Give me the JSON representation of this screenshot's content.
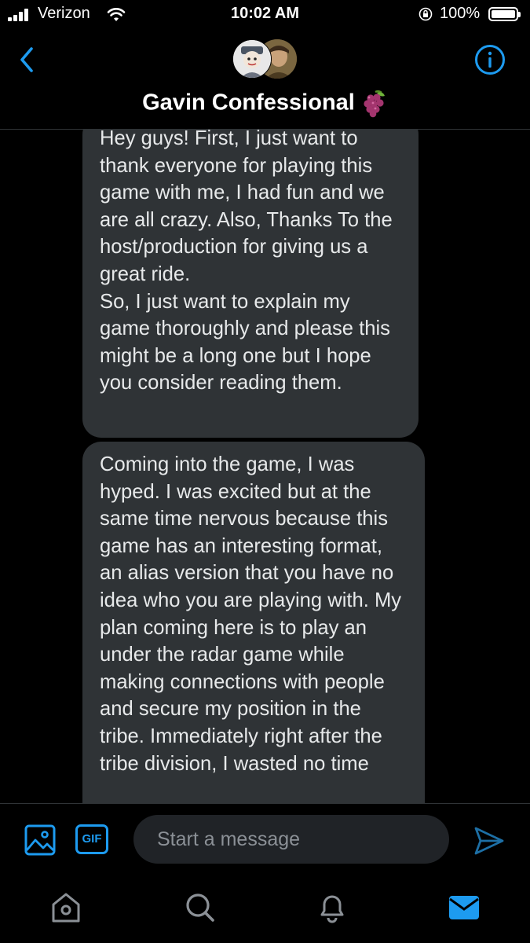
{
  "status_bar": {
    "carrier": "Verizon",
    "time": "10:02 AM",
    "battery": "100%"
  },
  "header": {
    "title": "Gavin Confessional",
    "title_emoji": "grape-icon",
    "back_icon": "chevron-left-icon",
    "info_icon": "info-icon"
  },
  "messages": [
    {
      "text": "Hey guys!  First, I just want to thank everyone for playing this game with me, I had fun and we are all crazy. Also, Thanks To the host/production for giving us a great ride.\nSo, I just want to explain my game thoroughly and please this might be a long one but I hope you consider reading them."
    },
    {
      "text": "Coming into the game, I was hyped. I was excited but at the same time nervous because this game has an interesting format, an alias version that you have no idea who you are playing with. My plan coming here is to play an under the radar game while making connections with people and secure my position in the tribe. Immediately right after the tribe division, I wasted no time"
    }
  ],
  "composer": {
    "placeholder": "Start a message",
    "gif_label": "GIF"
  },
  "colors": {
    "accent": "#1d9bf0",
    "bubble": "#2f3336",
    "background": "#000000"
  },
  "tabs": [
    "home-icon",
    "search-icon",
    "bell-icon",
    "mail-icon"
  ]
}
